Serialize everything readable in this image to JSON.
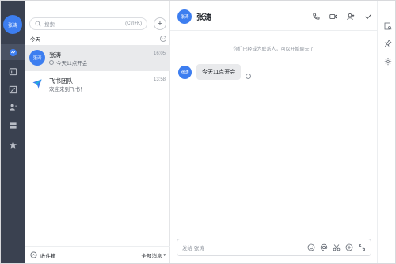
{
  "user": {
    "avatar_text": "张涛"
  },
  "search": {
    "placeholder": "搜索",
    "shortcut": "(Ctrl+K)"
  },
  "list": {
    "section_title": "今天",
    "chats": [
      {
        "avatar_text": "张涛",
        "name": "张涛",
        "time": "16:05",
        "preview": "今天11点开会"
      },
      {
        "avatar_text": "",
        "name": "飞书团队",
        "time": "13:58",
        "preview": "欢迎来到飞书！"
      }
    ],
    "footer_left": "收件箱",
    "footer_right": "全部消息"
  },
  "conversation": {
    "avatar_text": "张涛",
    "title": "张涛",
    "system_message": "你们已经成为联系人，可以开始聊天了",
    "messages": [
      {
        "avatar_text": "张涛",
        "text": "今天11点开会"
      }
    ],
    "composer_placeholder": "发给 张涛"
  },
  "colors": {
    "rail": "#3a4150",
    "accent": "#3d7ef0",
    "selected": "#e9eaec"
  }
}
